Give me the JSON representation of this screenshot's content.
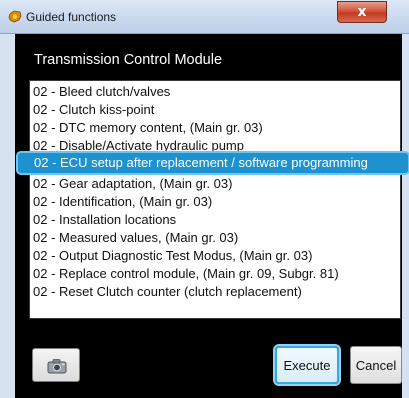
{
  "window": {
    "title": "Guided functions",
    "close_label": "x"
  },
  "header": {
    "title": "Transmission Control Module"
  },
  "functions": [
    "02 - Bleed clutch/valves",
    "02 - Clutch kiss-point",
    "02 - DTC memory content, (Main gr. 03)",
    "02 - Disable/Activate hydraulic pump",
    "02 - ECU setup after replacement / software programming",
    "02 - Gear adaptation, (Main gr. 03)",
    "02 - Identification, (Main gr. 03)",
    "02 - Installation locations",
    "02 - Measured values, (Main gr. 03)",
    "02 - Output Diagnostic Test Modus, (Main gr. 03)",
    "02 - Replace control module, (Main gr. 09, Subgr. 81)",
    "02 - Reset Clutch counter (clutch replacement)"
  ],
  "selected_index": 4,
  "buttons": {
    "camera_icon": "camera-icon",
    "execute_label": "Execute",
    "cancel_label": "Cancel"
  },
  "colors": {
    "selection": "#1d92cf",
    "selection_glow": "#6cc6f2",
    "background": "#000000"
  }
}
